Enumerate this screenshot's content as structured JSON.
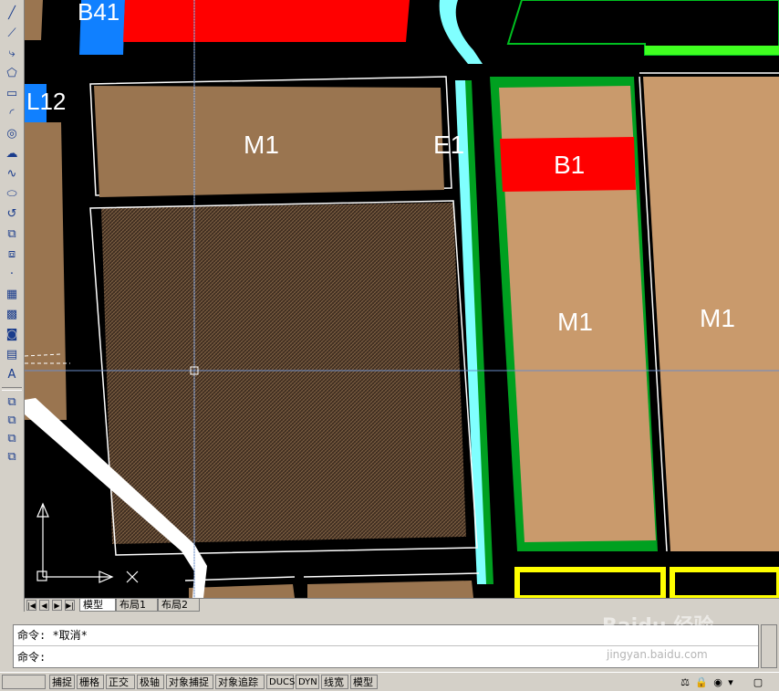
{
  "toolbar": {
    "tools": [
      {
        "name": "line-icon",
        "glyph": "╱"
      },
      {
        "name": "construction-line-icon",
        "glyph": "⟋"
      },
      {
        "name": "polyline-icon",
        "glyph": "⤷"
      },
      {
        "name": "polygon-icon",
        "glyph": "⬠"
      },
      {
        "name": "rectangle-icon",
        "glyph": "▭"
      },
      {
        "name": "arc-icon",
        "glyph": "◜"
      },
      {
        "name": "circle-icon",
        "glyph": "◎"
      },
      {
        "name": "revision-cloud-icon",
        "glyph": "☁"
      },
      {
        "name": "spline-icon",
        "glyph": "∿"
      },
      {
        "name": "ellipse-icon",
        "glyph": "⬭"
      },
      {
        "name": "ellipse-arc-icon",
        "glyph": "↺"
      },
      {
        "name": "insert-block-icon",
        "glyph": "⧉"
      },
      {
        "name": "make-block-icon",
        "glyph": "⧈"
      },
      {
        "name": "point-icon",
        "glyph": "·"
      },
      {
        "name": "hatch-icon",
        "glyph": "▦"
      },
      {
        "name": "gradient-icon",
        "glyph": "▩"
      },
      {
        "name": "region-icon",
        "glyph": "◙"
      },
      {
        "name": "table-icon",
        "glyph": "▤"
      },
      {
        "name": "multiline-text-icon",
        "glyph": "A"
      }
    ],
    "tools2": [
      {
        "name": "draw-order-icon",
        "glyph": "⧉"
      },
      {
        "name": "bring-front-icon",
        "glyph": "⧉"
      },
      {
        "name": "send-back-icon",
        "glyph": "⧉"
      },
      {
        "name": "bring-above-icon",
        "glyph": "⧉"
      }
    ]
  },
  "drawing": {
    "labels": {
      "b41": "B41",
      "l12": "L12",
      "m1_top": "M1",
      "e1": "E1",
      "b1": "B1",
      "m1_mid": "M1",
      "m1_right": "M1"
    },
    "ucs": {
      "x": "X",
      "y": "Y"
    },
    "colors": {
      "background": "#000000",
      "industrial_dark": "#9a7550",
      "industrial_light": "#c99a6c",
      "commercial": "#ff0000",
      "blue_plot": "#1080ff",
      "green_belt": "#00a020",
      "water": "#80ffff",
      "yellow": "#ffff00",
      "road_edge": "#ffffff",
      "crosshair": "#6a8cc8"
    }
  },
  "tabs": {
    "model": "模型",
    "layout1": "布局1",
    "layout2": "布局2",
    "nav": [
      "|◀",
      "◀",
      "▶",
      "▶|"
    ]
  },
  "command": {
    "line1": "命令: *取消*",
    "line2": "命令:"
  },
  "status": {
    "snap": "捕捉",
    "grid": "栅格",
    "ortho": "正交",
    "polar": "极轴",
    "osnap": "对象捕捉",
    "otrack": "对象追踪",
    "ducs": "DUCS",
    "dyn": "DYN",
    "lwt": "线宽",
    "model": "模型"
  },
  "watermark": {
    "text": "Baidu 经验",
    "sub": "jingyan.baidu.com"
  }
}
